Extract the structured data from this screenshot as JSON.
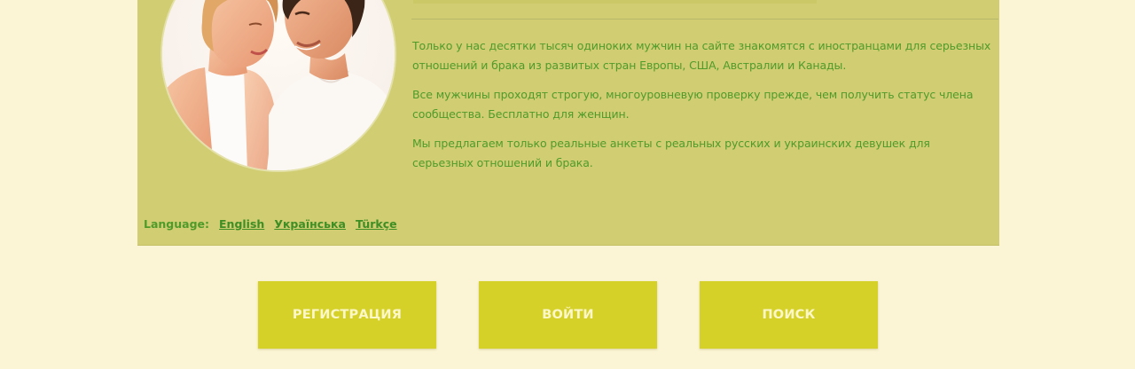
{
  "about": {
    "paragraphs": [
      "Только у нас десятки тысяч одиноких мужчин на сайте знакомятся с иностранцами для серьезных отношений и брака из развитых стран Европы, США, Австралии и Канады.",
      "Все мужчины проходят строгую, многоуровневую проверку прежде, чем получить статус члена сообщества. Бесплатно для женщин.",
      "Мы предлагаем только реальные анкеты с реальных русских и украинских девушек для серьезных отношений и брака."
    ]
  },
  "languages": {
    "label": "Language:",
    "items": [
      "English",
      "Українська",
      "Türkçe"
    ]
  },
  "buttons": {
    "register": "РЕГИСТРАЦИЯ",
    "login": "ВОЙТИ",
    "search": "ПОИСК"
  },
  "colors": {
    "page_bg": "#fbf4d5",
    "panel_bg": "#d0cd72",
    "text": "#4f9b2a",
    "button_bg": "#d6d128",
    "button_text": "#fbf7c8"
  }
}
